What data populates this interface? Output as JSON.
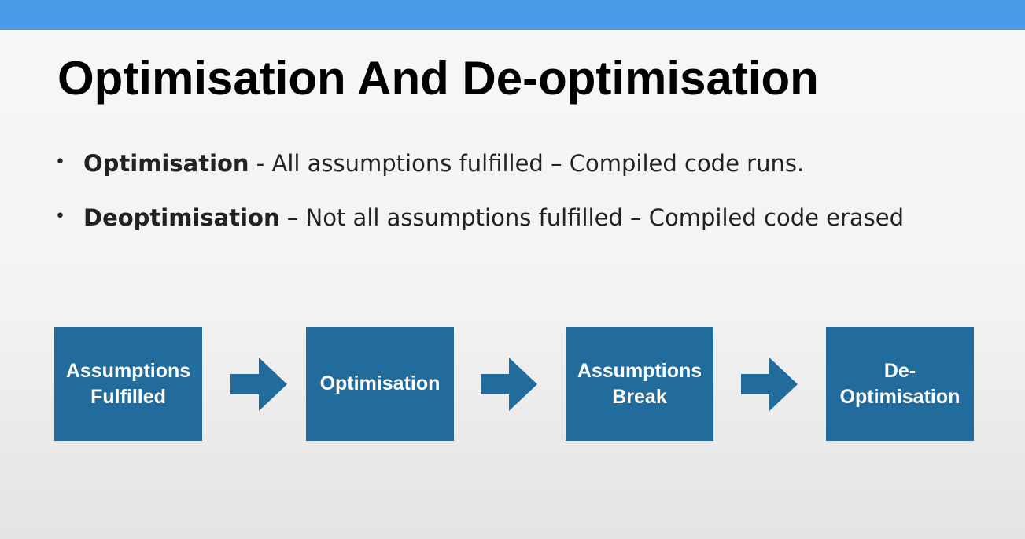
{
  "slide": {
    "title": "Optimisation And De-optimisation",
    "bullets": [
      {
        "term": "Optimisation",
        "text": " - All assumptions fulfilled – Compiled code runs."
      },
      {
        "term": "Deoptimisation",
        "text": " – Not all assumptions fulfilled  – Compiled code erased"
      }
    ],
    "flow": {
      "steps": [
        "Assumptions Fulfilled",
        "Optimisation",
        "Assumptions Break",
        "De-Optimisation"
      ],
      "arrow_icon": "right-arrow-icon"
    }
  },
  "colors": {
    "top_bar": "#4a9be6",
    "box_fill": "#226c9d",
    "arrow_fill": "#226c9d",
    "box_text": "#ffffff"
  }
}
